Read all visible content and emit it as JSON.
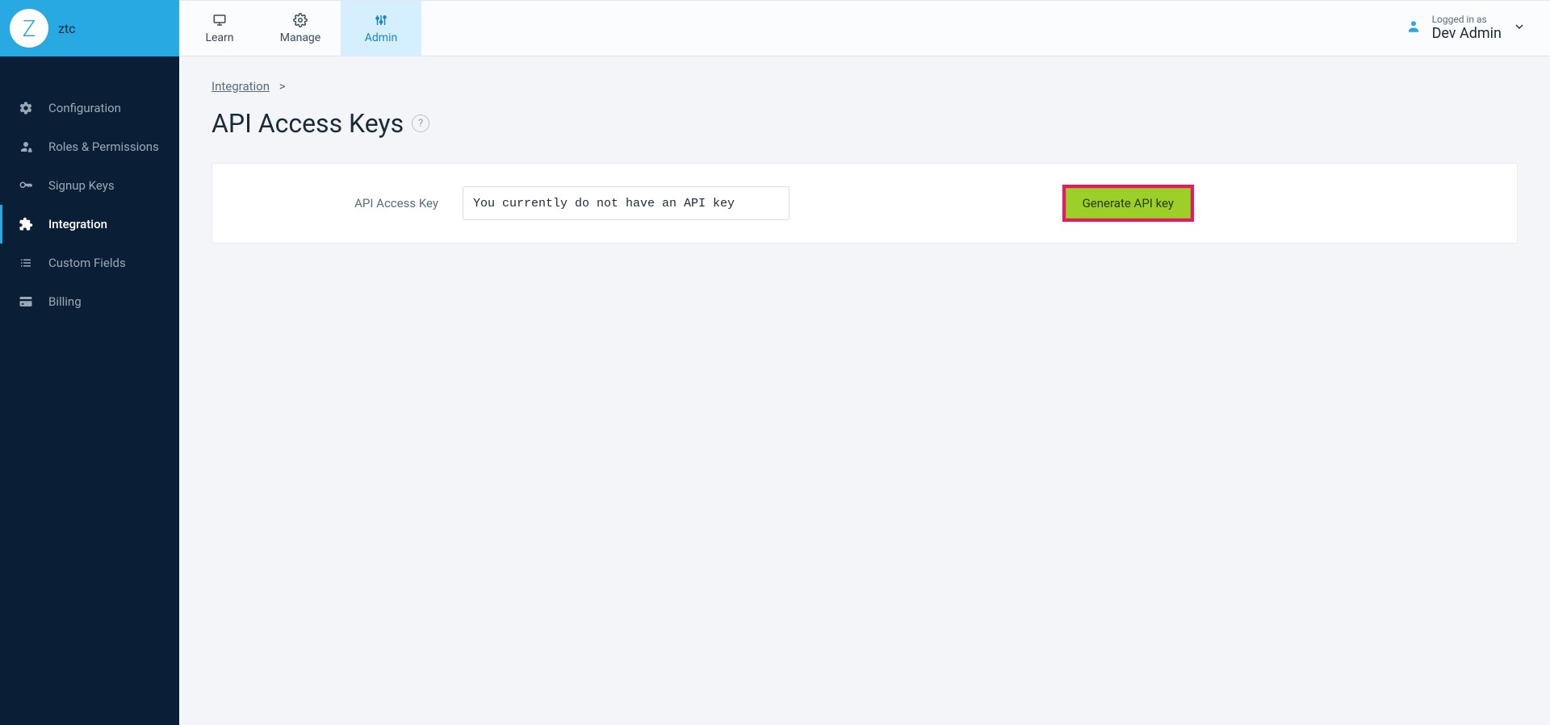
{
  "brand": {
    "logo_letter": "Z",
    "name": "ztc"
  },
  "top_tabs": {
    "learn": "Learn",
    "manage": "Manage",
    "admin": "Admin"
  },
  "user": {
    "logged_in_as_label": "Logged in as",
    "name": "Dev Admin"
  },
  "sidebar": {
    "items": [
      {
        "label": "Configuration"
      },
      {
        "label": "Roles & Permissions"
      },
      {
        "label": "Signup Keys"
      },
      {
        "label": "Integration"
      },
      {
        "label": "Custom Fields"
      },
      {
        "label": "Billing"
      }
    ]
  },
  "breadcrumb": {
    "link": "Integration",
    "sep": ">"
  },
  "page": {
    "title": "API Access Keys",
    "help": "?"
  },
  "card": {
    "field_label": "API Access Key",
    "input_value": "You currently do not have an API key",
    "generate_button": "Generate API key"
  },
  "colors": {
    "brand_blue": "#29a9e1",
    "sidebar_bg": "#0a1f35",
    "highlight_pink": "#ed1566",
    "button_green": "#9ccf27"
  }
}
